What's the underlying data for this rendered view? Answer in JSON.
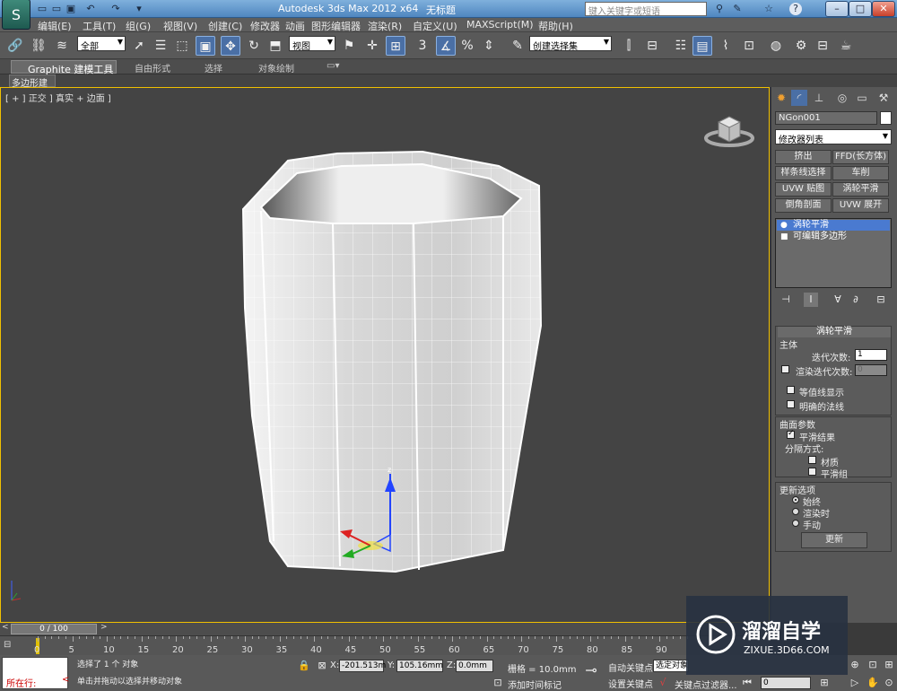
{
  "titlebar": {
    "title": "Autodesk 3ds Max  2012 x64",
    "filename": "无标题",
    "search_placeholder": "键入关键字或短语",
    "minimize": "–",
    "maximize": "□",
    "close": "✕",
    "help": "?"
  },
  "menus": [
    "编辑(E)",
    "工具(T)",
    "组(G)",
    "视图(V)",
    "创建(C)",
    "修改器",
    "动画",
    "图形编辑器",
    "渲染(R)",
    "自定义(U)",
    "MAXScript(M)",
    "帮助(H)"
  ],
  "toolbar": {
    "selection_filter": "全部",
    "ref_coord": "视图",
    "named_selection": "创建选择集",
    "snap_angle_label": "3",
    "percent_label": "%"
  },
  "ribbon": {
    "tabs": [
      "Graphite 建模工具",
      "自由形式",
      "选择",
      "对象绘制"
    ],
    "subtab": "多边形建模"
  },
  "viewport": {
    "label": "[ + ] 正交 ] 真实 + 边面 ]",
    "gizmo_z": "z"
  },
  "panel": {
    "object_name": "NGon001",
    "object_color": "#ffffff",
    "modifier_list": "修改器列表",
    "modifier_buttons": [
      "挤出",
      "FFD(长方体)",
      "样条线选择",
      "车削",
      "UVW 贴图",
      "涡轮平滑",
      "倒角剖面",
      "UVW 展开"
    ],
    "stack": [
      {
        "label": "涡轮平滑",
        "selected": true
      },
      {
        "label": "可编辑多边形",
        "selected": false
      }
    ],
    "turbosmooth": {
      "title": "涡轮平滑",
      "main_label": "主体",
      "iterations_label": "迭代次数:",
      "iterations_value": "1",
      "render_iters_label": "渲染迭代次数:",
      "render_iters_value": "0",
      "isoline_label": "等值线显示",
      "explicit_normals_label": "明确的法线",
      "surface_label": "曲面参数",
      "smooth_result_label": "平滑结果",
      "separate_label": "分隔方式:",
      "materials_label": "材质",
      "smoothing_groups_label": "平滑组",
      "update_label": "更新选项",
      "always_label": "始终",
      "when_rendering_label": "渲染时",
      "manually_label": "手动",
      "update_button": "更新"
    }
  },
  "timeline": {
    "slider_text": "0 / 100",
    "ticks": [
      "0",
      "5",
      "10",
      "15",
      "20",
      "25",
      "30",
      "35",
      "40",
      "45",
      "50",
      "55",
      "60",
      "65",
      "70",
      "75",
      "80",
      "85",
      "90"
    ]
  },
  "status": {
    "maxscript_text": "所在行:",
    "selection_text": "选择了 1 个 对象",
    "prompt_text": "单击并拖动以选择并移动对象",
    "x_label": "X:",
    "x_value": "-201.513m",
    "y_label": "Y:",
    "y_value": "105.16mm",
    "z_label": "Z:",
    "z_value": "0.0mm",
    "grid_text": "栅格 = 10.0mm",
    "add_time_tag": "添加时间标记",
    "auto_key": "自动关键点",
    "set_key": "设置关键点",
    "selected_label": "选定对象",
    "key_filters": "关键点过滤器...",
    "frame_value": "0"
  },
  "watermark": {
    "brand": "溜溜自学",
    "url": "ZIXUE.3D66.COM"
  }
}
